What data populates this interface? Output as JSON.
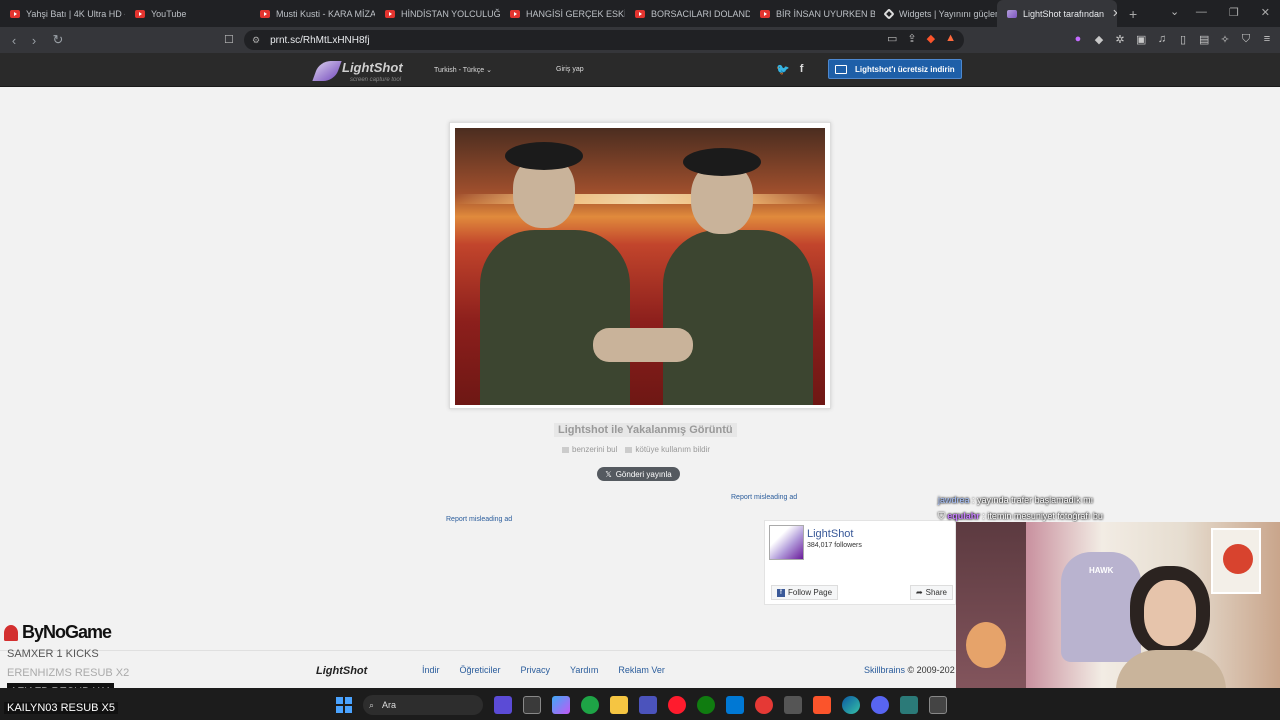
{
  "browser": {
    "tabs": [
      {
        "label": "Yahşi Batı | 4K Ultra HD -",
        "icon": "youtube-icon"
      },
      {
        "label": "YouTube",
        "icon": "youtube-icon"
      },
      {
        "label": "Musti Kusti - KARA MİZAH",
        "icon": "youtube-icon"
      },
      {
        "label": "HİNDİSTAN YOLCULUĞU",
        "icon": "youtube-icon"
      },
      {
        "label": "HANGİSİ GERÇEK ESKİ SE",
        "icon": "youtube-icon"
      },
      {
        "label": "BORSACILARI DOLANDIR",
        "icon": "youtube-icon"
      },
      {
        "label": "BİR İNSAN UYURKEN BİR",
        "icon": "youtube-icon"
      },
      {
        "label": "Widgets | Yayınını güçlen",
        "icon": "diamond-icon"
      },
      {
        "label": "LightShot tarafından",
        "icon": "lightshot-icon"
      }
    ],
    "url": "prnt.sc/RhMtLxHNH8fj"
  },
  "lightshot": {
    "logo": "LightShot",
    "tagline": "screen capture tool",
    "language": "Turkish - Türkçe",
    "language_arrow": "⌄",
    "login": "Giriş yap",
    "download": "Lightshot'ı ücretsiz indirin",
    "caption": "Lightshot ile Yakalanmış Görüntü",
    "similar": "benzerini bul",
    "report_abuse": "kötüye kullanım bildir",
    "tweet": "Gönderi yayınla",
    "ad_report_1": "Report misleading ad",
    "ad_report_2": "Report misleading ad"
  },
  "facebook": {
    "name": "LightShot",
    "followers": "384,017 followers",
    "follow": "Follow Page",
    "share": "Share"
  },
  "chat": [
    {
      "user": "jawdrea",
      "msg": ": yayında trafer başlamadık mı"
    },
    {
      "user": "equlahr",
      "msg": ": itemin mesuniyet fotoğrafı bu"
    }
  ],
  "footer": {
    "logo": "LightShot",
    "links": [
      "İndir",
      "Öğreticiler",
      "Privacy",
      "Yardım",
      "Reklam Ver"
    ],
    "company": "Skillbrains",
    "copyright": "© 2009-202"
  },
  "stream": {
    "sponsor": "ByNoGame",
    "events": [
      {
        "text": "SAMXER  1 KICKS",
        "style": "normal"
      },
      {
        "text": "ERENHIZMS  RESUB X2",
        "style": "dim"
      },
      {
        "text": "AFIAFB  RESUB X11",
        "style": "hi"
      },
      {
        "text": "KAILYN03  RESUB X5",
        "style": "hi"
      }
    ],
    "webcam_chair_label": "HAWK"
  },
  "taskbar": {
    "search": "Ara"
  },
  "colors": {
    "download_button": "#1e5fa8",
    "link": "#2b5d9c",
    "header_bg": "#2a2a2a"
  }
}
